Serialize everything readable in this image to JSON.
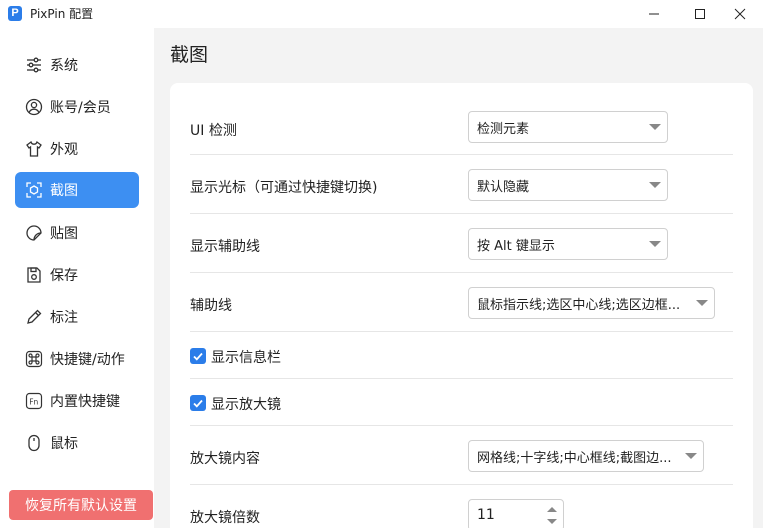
{
  "window": {
    "app_title": "PixPin 配置",
    "logo_letter": "P"
  },
  "sidebar": {
    "items": [
      {
        "label": "系统",
        "icon": "sliders-icon"
      },
      {
        "label": "账号/会员",
        "icon": "user-circle-icon"
      },
      {
        "label": "外观",
        "icon": "shirt-icon"
      },
      {
        "label": "截图",
        "icon": "screenshot-icon"
      },
      {
        "label": "贴图",
        "icon": "sticker-icon"
      },
      {
        "label": "保存",
        "icon": "save-icon"
      },
      {
        "label": "标注",
        "icon": "pencil-icon"
      },
      {
        "label": "快捷键/动作",
        "icon": "command-key-icon"
      },
      {
        "label": "内置快捷键",
        "icon": "fn-key-icon"
      },
      {
        "label": "鼠标",
        "icon": "mouse-icon"
      }
    ],
    "active_index": 3,
    "reset_label": "恢复所有默认设置"
  },
  "main": {
    "title": "截图",
    "ui_detect": {
      "label": "UI 检测",
      "value": "检测元素"
    },
    "show_cursor": {
      "label": "显示光标（可通过快捷键切换)",
      "value": "默认隐藏"
    },
    "show_guides": {
      "label": "显示辅助线",
      "value": "按 Alt 键显示"
    },
    "guides": {
      "label": "辅助线",
      "value": "鼠标指示线;选区中心线;选区边框..."
    },
    "show_infobar": {
      "label": "显示信息栏",
      "checked": true
    },
    "show_magnifier": {
      "label": "显示放大镜",
      "checked": true
    },
    "magnifier_content": {
      "label": "放大镜内容",
      "value": "网格线;十字线;中心框线;截图边..."
    },
    "magnifier_scale": {
      "label": "放大镜倍数",
      "value": "11"
    }
  },
  "colors": {
    "accent": "#3d8ff2",
    "checkbox": "#2b7de9",
    "reset": "#f07070"
  }
}
